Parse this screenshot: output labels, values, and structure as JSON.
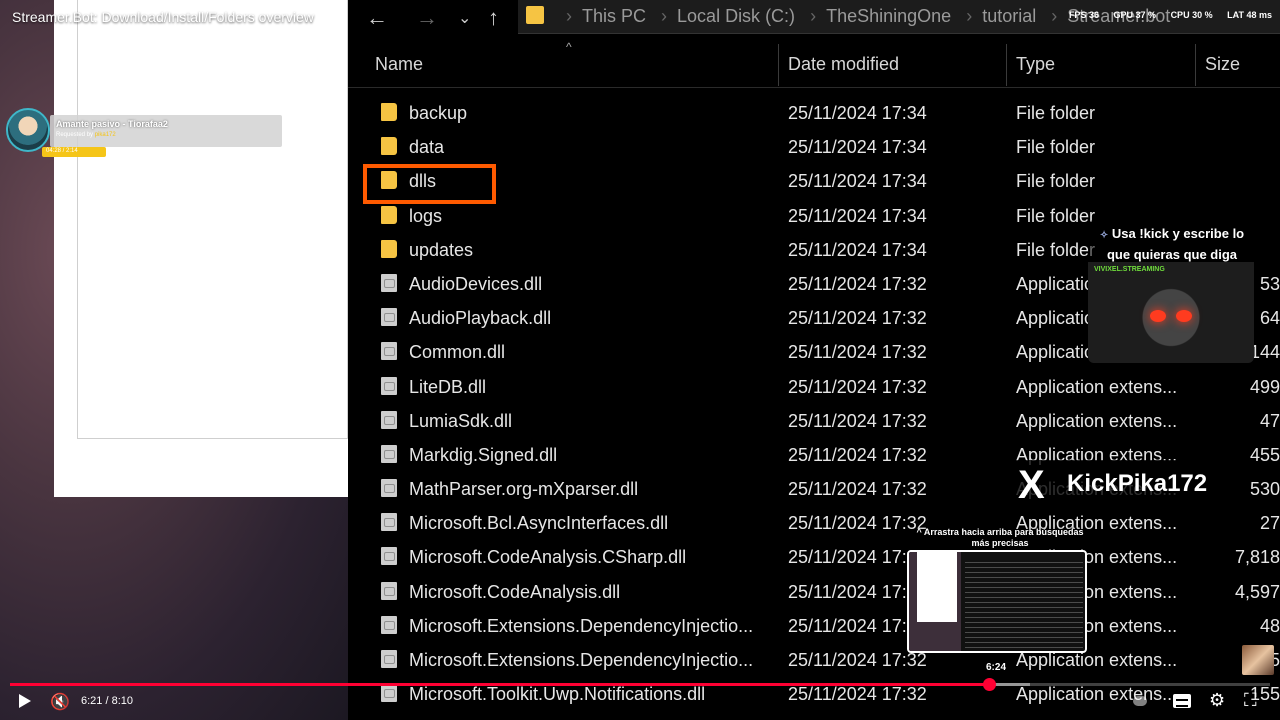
{
  "video": {
    "title": "Streamer.Bot: Download/Install/Folders overview",
    "current_time": "6:21",
    "duration": "8:10",
    "time_display": "6:21 / 8:10",
    "progress_fraction": 0.777,
    "hover_preview_time": "6:24",
    "preview_hint": "Arrastra hacia arriba para búsquedas más precisas"
  },
  "song_widget": {
    "title": "Amante pasivo - Tiorafaa2",
    "requested_by_label": "Requested by",
    "requested_by": "pika172",
    "progress_text": "04:28 / 2:14"
  },
  "nav": {
    "back": "←",
    "forward": "→",
    "recent": "⌄",
    "up": "↑",
    "breadcrumbs": [
      "This PC",
      "Local Disk (C:)",
      "TheShiningOne",
      "tutorial",
      "Streamer.bot"
    ]
  },
  "perf": {
    "fps_label": "FPS",
    "fps": "36",
    "gpu_label": "GPU",
    "gpu": "37 %",
    "cpu_label": "CPU",
    "cpu": "30 %",
    "lat_label": "LAT",
    "lat": "48 ms"
  },
  "columns": {
    "name": "Name",
    "date": "Date modified",
    "type": "Type",
    "size": "Size"
  },
  "files": [
    {
      "name": "backup",
      "date": "25/11/2024 17:34",
      "type": "File folder",
      "size": "",
      "kind": "folder"
    },
    {
      "name": "data",
      "date": "25/11/2024 17:34",
      "type": "File folder",
      "size": "",
      "kind": "folder"
    },
    {
      "name": "dlls",
      "date": "25/11/2024 17:34",
      "type": "File folder",
      "size": "",
      "kind": "folder"
    },
    {
      "name": "logs",
      "date": "25/11/2024 17:34",
      "type": "File folder",
      "size": "",
      "kind": "folder"
    },
    {
      "name": "updates",
      "date": "25/11/2024 17:34",
      "type": "File folder",
      "size": "",
      "kind": "folder"
    },
    {
      "name": "AudioDevices.dll",
      "date": "25/11/2024 17:32",
      "type": "Application extens...",
      "size": "53",
      "kind": "file"
    },
    {
      "name": "AudioPlayback.dll",
      "date": "25/11/2024 17:32",
      "type": "Application extens...",
      "size": "64",
      "kind": "file"
    },
    {
      "name": "Common.dll",
      "date": "25/11/2024 17:32",
      "type": "Application extens...",
      "size": "144",
      "kind": "file"
    },
    {
      "name": "LiteDB.dll",
      "date": "25/11/2024 17:32",
      "type": "Application extens...",
      "size": "499",
      "kind": "file"
    },
    {
      "name": "LumiaSdk.dll",
      "date": "25/11/2024 17:32",
      "type": "Application extens...",
      "size": "47",
      "kind": "file"
    },
    {
      "name": "Markdig.Signed.dll",
      "date": "25/11/2024 17:32",
      "type": "Application extens...",
      "size": "455",
      "kind": "file"
    },
    {
      "name": "MathParser.org-mXparser.dll",
      "date": "25/11/2024 17:32",
      "type": "Application extens...",
      "size": "530",
      "kind": "file"
    },
    {
      "name": "Microsoft.Bcl.AsyncInterfaces.dll",
      "date": "25/11/2024 17:32",
      "type": "Application extens...",
      "size": "27",
      "kind": "file"
    },
    {
      "name": "Microsoft.CodeAnalysis.CSharp.dll",
      "date": "25/11/2024 17:32",
      "type": "Application extens...",
      "size": "7,818",
      "kind": "file"
    },
    {
      "name": "Microsoft.CodeAnalysis.dll",
      "date": "25/11/2024 17:32",
      "type": "Application extens...",
      "size": "4,597",
      "kind": "file"
    },
    {
      "name": "Microsoft.Extensions.DependencyInjectio...",
      "date": "25/11/2024 17:32",
      "type": "Application extens...",
      "size": "48",
      "kind": "file"
    },
    {
      "name": "Microsoft.Extensions.DependencyInjectio...",
      "date": "25/11/2024 17:32",
      "type": "Application extens...",
      "size": "15",
      "kind": "file"
    },
    {
      "name": "Microsoft.Toolkit.Uwp.Notifications.dll",
      "date": "25/11/2024 17:32",
      "type": "Application extens...",
      "size": "155",
      "kind": "file"
    }
  ],
  "kick_popup": {
    "text": "Usa !kick y escribe lo que quieras que diga",
    "username": "VIVIXEL.STREAMING"
  },
  "social": {
    "icon": "X",
    "handle": "KickPika172"
  },
  "colors": {
    "highlight": "#ff5a00",
    "folder": "#f6c443",
    "progress": "#ff0033"
  }
}
